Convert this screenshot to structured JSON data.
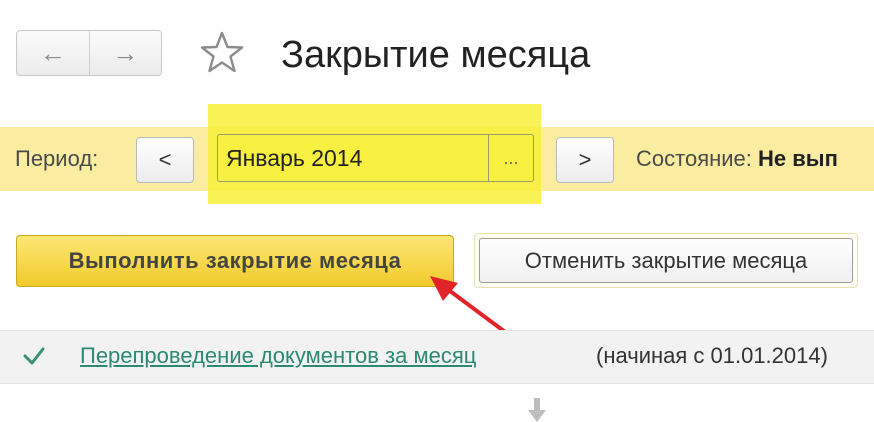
{
  "header": {
    "back_icon": "arrow-left-icon",
    "forward_icon": "arrow-right-icon",
    "favorite_icon": "star-icon",
    "title": "Закрытие месяца"
  },
  "period": {
    "label": "Период:",
    "prev_label": "<",
    "value": "Январь 2014",
    "select_label": "...",
    "next_label": ">",
    "status_label": "Состояние:",
    "status_value": "Не вып"
  },
  "actions": {
    "run_label": "Выполнить закрытие месяца",
    "cancel_label": "Отменить закрытие месяца"
  },
  "tasks": [
    {
      "icon": "check-icon",
      "link": "Перепроведение документов за месяц",
      "note": "(начиная с 01.01.2014)"
    }
  ],
  "colors": {
    "highlight": "#f7f03a",
    "period_bar": "#faeda2",
    "run_button": "#f1cb2c",
    "link": "#2b8a70",
    "annotation_arrow": "#e2232a"
  }
}
